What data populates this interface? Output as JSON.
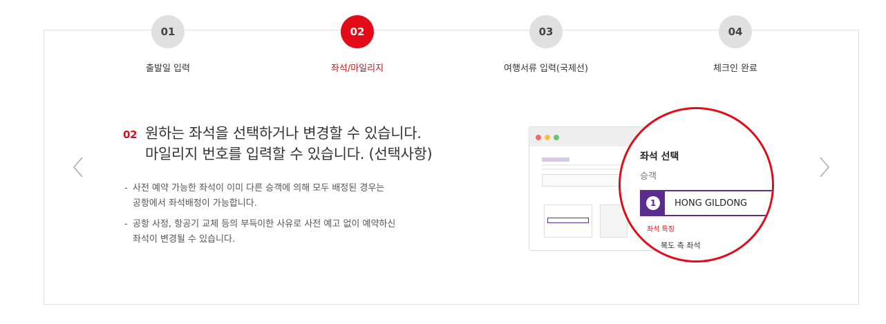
{
  "steps": [
    {
      "number": "01",
      "label": "출발일 입력",
      "active": false
    },
    {
      "number": "02",
      "label": "좌석/마일리지",
      "active": true
    },
    {
      "number": "03",
      "label": "여행서류 입력(국제선)",
      "active": false
    },
    {
      "number": "04",
      "label": "체크인 완료",
      "active": false
    }
  ],
  "colors": {
    "accent": "#e30b17",
    "purple": "#5b2c8e",
    "inactive": "#e0e0e0"
  },
  "icons": {
    "prev": "chevron-left-icon",
    "next": "chevron-right-icon"
  },
  "content": {
    "number": "02",
    "headline_line1": "원하는 좌석을 선택하거나 변경할 수 있습니다.",
    "headline_line2": "마일리지 번호를 입력할 수 있습니다. (선택사항)",
    "bullets": [
      {
        "line1": "사전 예약 가능한 좌석이 이미 다른 승객에 의해 모두 배정된 경우는",
        "line2": "공항에서 좌석배정이 가능합니다."
      },
      {
        "line1": "공항 사정, 항공기 교체 등의 부득이한 사유로 사전 예고 없이 예약하신",
        "line2": "좌석이 변경될 수 있습니다."
      }
    ]
  },
  "preview": {
    "zoom": {
      "title": "좌석 선택",
      "subtitle": "승객",
      "passenger_number": "1",
      "passenger_name": "HONG GILDONG",
      "feature_label": "좌석 특징",
      "feature_value": "복도 측 좌석"
    }
  }
}
